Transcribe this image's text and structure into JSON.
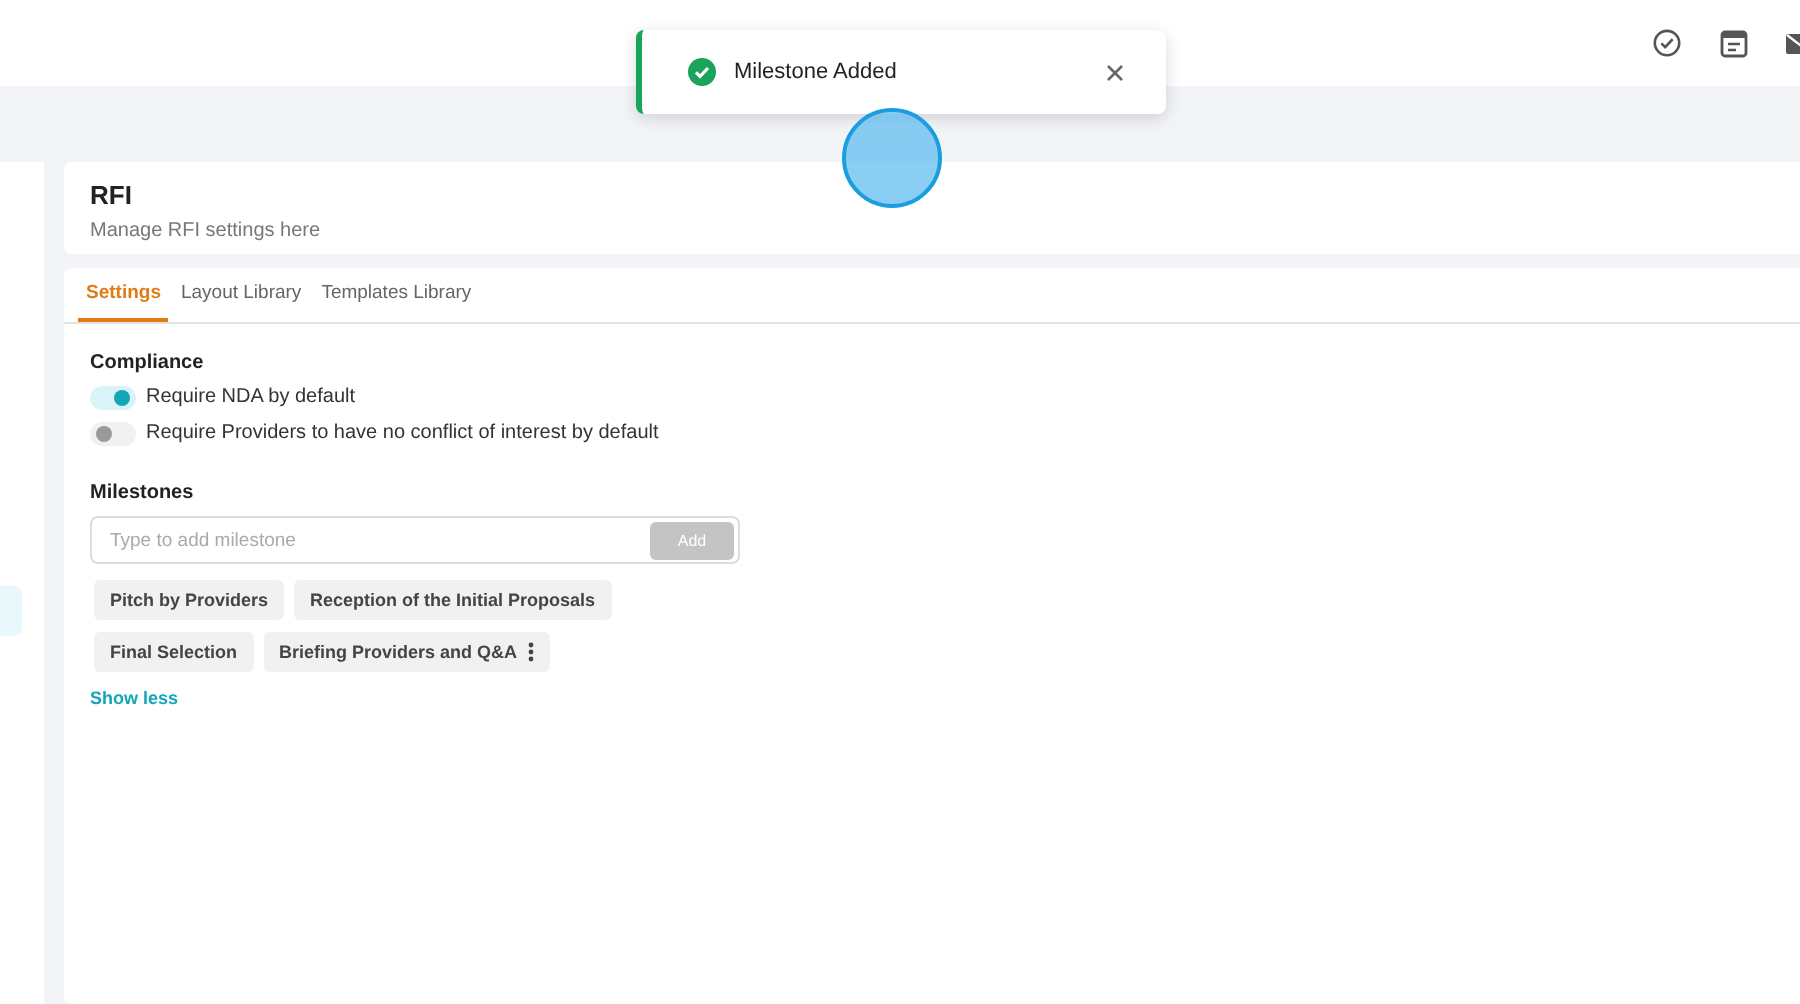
{
  "toast": {
    "message": "Milestone Added"
  },
  "header": {
    "title": "RFI",
    "subtitle": "Manage RFI settings here"
  },
  "tabs": [
    {
      "label": "Settings",
      "selected": true
    },
    {
      "label": "Layout Library",
      "selected": false
    },
    {
      "label": "Templates Library",
      "selected": false
    }
  ],
  "compliance": {
    "title": "Compliance",
    "toggles": [
      {
        "label": "Require NDA by default",
        "on": true
      },
      {
        "label": "Require Providers to have no conflict of interest by default",
        "on": false
      }
    ]
  },
  "milestones": {
    "title": "Milestones",
    "placeholder": "Type to add milestone",
    "add_button": "Add",
    "add_disabled": true,
    "chips": [
      {
        "label": "Pitch by Providers",
        "menu": false
      },
      {
        "label": "Reception of the Initial Proposals",
        "menu": false
      },
      {
        "label": "Final Selection",
        "menu": false
      },
      {
        "label": "Briefing Providers and Q&A",
        "menu": true
      }
    ],
    "show_less": "Show less"
  }
}
